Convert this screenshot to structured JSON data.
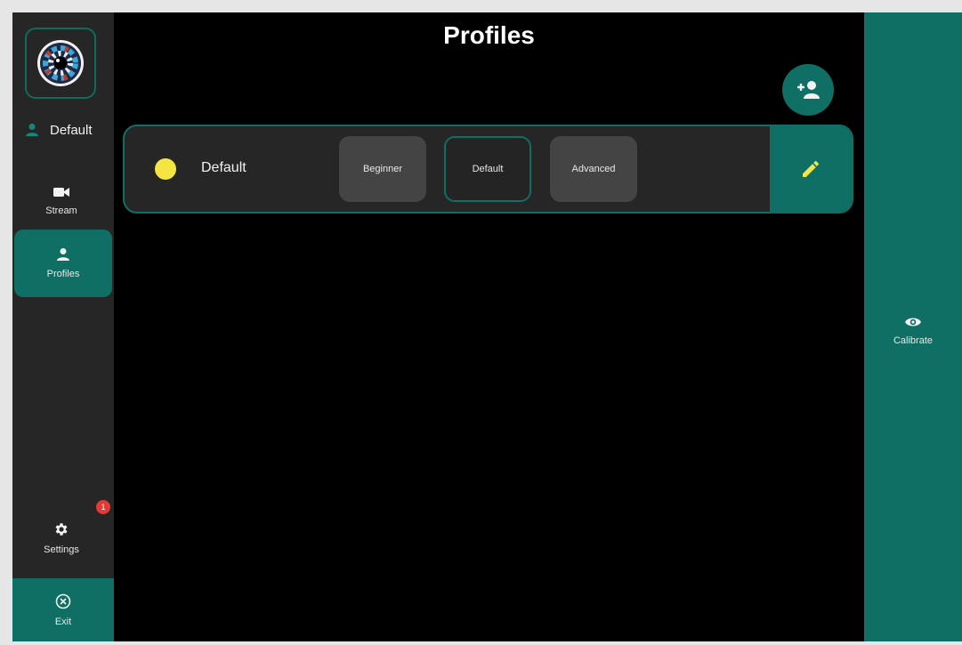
{
  "header": {
    "title": "Profiles"
  },
  "sidebar": {
    "current_user": "Default",
    "nav": {
      "stream": "Stream",
      "profiles": "Profiles",
      "settings": "Settings",
      "settings_badge": "1",
      "exit": "Exit"
    }
  },
  "profiles": [
    {
      "name": "Default",
      "color": "#f4e542",
      "levels": [
        "Beginner",
        "Default",
        "Advanced"
      ],
      "selected_level": "Default"
    }
  ],
  "right_panel": {
    "calibrate": "Calibrate"
  },
  "colors": {
    "accent": "#0f6f64",
    "sidebar_bg": "#262626",
    "main_bg": "#000000",
    "badge": "#e53935",
    "edit_icon": "#f4e542"
  },
  "icons": {
    "logo": "eye-iris-logo",
    "user": "person-icon",
    "stream": "video-camera-icon",
    "profiles": "person-icon",
    "settings": "gear-icon",
    "exit": "circle-x-icon",
    "add_profile": "add-user-icon",
    "edit": "pencil-icon",
    "calibrate": "eye-icon"
  }
}
